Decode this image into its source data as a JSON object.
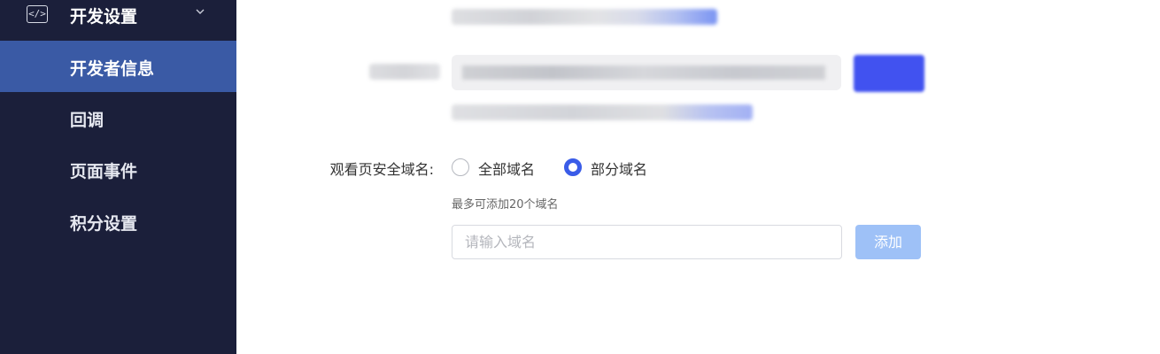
{
  "sidebar": {
    "group": {
      "icon": "code-icon",
      "icon_glyph": "</>",
      "title": "开发设置"
    },
    "items": [
      {
        "label": "开发者信息",
        "active": true
      },
      {
        "label": "回调",
        "active": false
      },
      {
        "label": "页面事件",
        "active": false
      },
      {
        "label": "积分设置",
        "active": false
      }
    ]
  },
  "main": {
    "domain_setting": {
      "label": "观看页安全域名:",
      "options": [
        {
          "label": "全部域名",
          "checked": false
        },
        {
          "label": "部分域名",
          "checked": true
        }
      ],
      "hint": "最多可添加20个域名",
      "input_placeholder": "请输入域名",
      "input_value": "",
      "add_label": "添加"
    }
  },
  "colors": {
    "sidebar_bg": "#1b1f3a",
    "active_item_bg": "#3a5aa5",
    "radio_checked": "#3a5ce8",
    "add_button_bg": "#9ec1f7"
  }
}
